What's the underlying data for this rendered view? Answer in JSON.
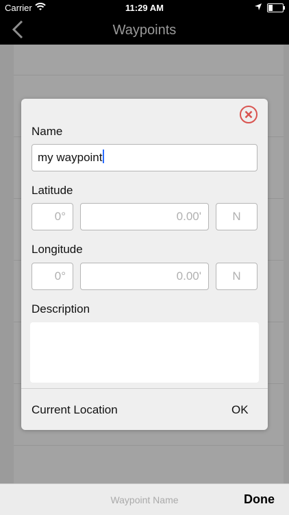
{
  "status_bar": {
    "carrier": "Carrier",
    "time": "11:29 AM"
  },
  "nav": {
    "title": "Waypoints"
  },
  "dialog": {
    "name_label": "Name",
    "name_value": "my waypoint",
    "latitude_label": "Latitude",
    "latitude": {
      "degrees_placeholder": "0°",
      "minutes_placeholder": "0.00'",
      "hemisphere": "N"
    },
    "longitude_label": "Longitude",
    "longitude": {
      "degrees_placeholder": "0°",
      "minutes_placeholder": "0.00'",
      "hemisphere": "N"
    },
    "description_label": "Description",
    "description_value": "",
    "current_location_label": "Current Location",
    "ok_label": "OK"
  },
  "bottom_bar": {
    "placeholder": "Waypoint Name",
    "done_label": "Done"
  },
  "colors": {
    "close_icon": "#d9534f",
    "caret": "#2a6cff"
  }
}
